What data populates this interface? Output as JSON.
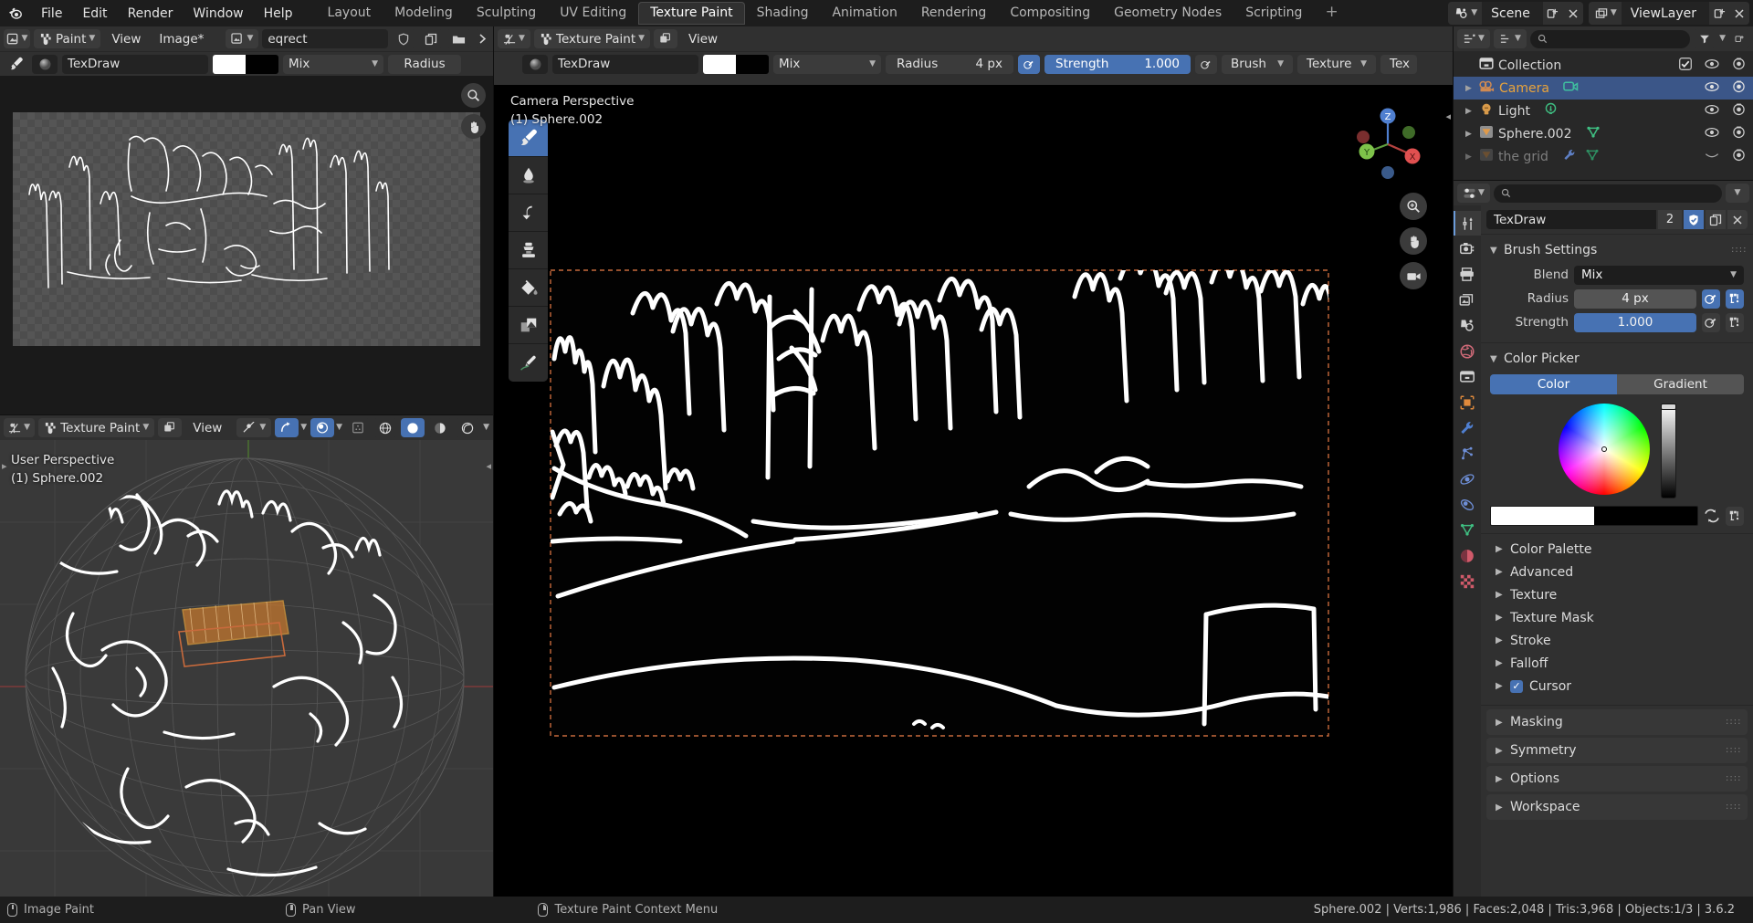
{
  "app": {
    "title": "Blender",
    "version": "3.6.2"
  },
  "topbar": {
    "logo_icon": "blender-logo-icon",
    "menus": [
      "File",
      "Edit",
      "Render",
      "Window",
      "Help"
    ],
    "workspace_tabs": [
      {
        "label": "Layout",
        "active": false
      },
      {
        "label": "Modeling",
        "active": false
      },
      {
        "label": "Sculpting",
        "active": false
      },
      {
        "label": "UV Editing",
        "active": false
      },
      {
        "label": "Texture Paint",
        "active": true
      },
      {
        "label": "Shading",
        "active": false
      },
      {
        "label": "Animation",
        "active": false
      },
      {
        "label": "Rendering",
        "active": false
      },
      {
        "label": "Compositing",
        "active": false
      },
      {
        "label": "Geometry Nodes",
        "active": false
      },
      {
        "label": "Scripting",
        "active": false
      }
    ],
    "add_workspace_label": "+",
    "scene": {
      "icon": "scene-icon",
      "name": "Scene",
      "new_icon": "new-scene-icon",
      "unlink_icon": "unlink-icon"
    },
    "viewlayer": {
      "icon": "view-layer-icon",
      "name": "ViewLayer"
    }
  },
  "image_editor": {
    "editor_type_icon": "image-editor-icon",
    "mode": "Paint",
    "menus": [
      "View",
      "Image*"
    ],
    "image_datablock": {
      "icon": "image-data-icon",
      "name": "eqrect",
      "fake_user_icon": "shield-icon",
      "copy_icon": "copy-icon",
      "open_icon": "folder-icon",
      "more_icon": "chevron-right-icon"
    },
    "tool_row": {
      "brush_icon": "brush-icon",
      "brush_preview_icon": "brush-preview-icon",
      "brush_name": "TexDraw",
      "color_primary": "#ffffff",
      "color_secondary": "#010101",
      "blend": "Mix",
      "radius_label": "Radius"
    }
  },
  "viewport_left": {
    "editor_type_icon": "3d-viewport-icon",
    "mode": "Texture Paint",
    "overlay_icon": "mode-overlay-icon",
    "menus": [
      "View"
    ],
    "header_icons": [
      "visibility-icon",
      "snap-icon",
      "proportional-edit-icon",
      "show-gizmo-icon",
      "shading-wireframe-icon",
      "shading-solid-icon",
      "shading-material-icon",
      "shading-rendered-icon"
    ],
    "overlay_text_line1": "User Perspective",
    "overlay_text_line2": "(1) Sphere.002"
  },
  "viewport_main": {
    "editor_type_icon": "3d-viewport-icon",
    "mode": "Texture Paint",
    "overlay_icon": "mode-overlay-icon",
    "menus": [
      "View"
    ],
    "tool_row": {
      "brush_preview_icon": "brush-preview-icon",
      "brush_name": "TexDraw",
      "color_primary": "#ffffff",
      "color_secondary": "#010101",
      "blend": "Mix",
      "radius_label": "Radius",
      "radius_value": "4 px",
      "radius_pressure_icon": "pressure-icon",
      "strength_label": "Strength",
      "strength_value": "1.000",
      "strength_pressure_icon": "pressure-icon",
      "menus": [
        "Brush",
        "Texture",
        "Tex"
      ]
    },
    "overlay_text_line1": "Camera Perspective",
    "overlay_text_line2": "(1) Sphere.002",
    "toolbar": [
      {
        "name": "draw-tool",
        "icon": "brush-icon",
        "active": true
      },
      {
        "name": "soften-tool",
        "icon": "soften-drop-icon",
        "active": false
      },
      {
        "name": "smear-tool",
        "icon": "smear-icon",
        "active": false
      },
      {
        "name": "clone-tool",
        "icon": "clone-stamp-icon",
        "active": false
      },
      {
        "name": "fill-tool",
        "icon": "fill-bucket-icon",
        "active": false
      },
      {
        "name": "mask-tool",
        "icon": "mask-icon",
        "active": false
      },
      {
        "name": "annotate-tool",
        "icon": "annotate-pencil-icon",
        "active": false
      }
    ],
    "gizmo_axes": [
      "Z",
      "X",
      "Y"
    ],
    "nav_buttons": [
      "zoom-icon",
      "hand-pan-icon",
      "camera-view-icon"
    ]
  },
  "outliner": {
    "display_mode_icon": "outliner-icon",
    "filter_icon": "filter-icon",
    "search_placeholder": "",
    "search_icon": "search-icon",
    "new_collection_icon": "new-collection-icon",
    "rows": [
      {
        "label": "Collection",
        "icon": "collection-icon",
        "indent": 0,
        "expand": "",
        "selected": false,
        "dim": false,
        "checkbox": true,
        "hide": "eye-icon",
        "render": "camera-render-icon",
        "datatype": ""
      },
      {
        "label": "Camera",
        "icon": "camera-object-icon",
        "indent": 1,
        "expand": "▶",
        "selected": true,
        "dim": false,
        "checkbox": false,
        "hide": "eye-icon",
        "render": "camera-render-icon",
        "datatype": "camera-data-icon"
      },
      {
        "label": "Light",
        "icon": "light-object-icon",
        "indent": 1,
        "expand": "▶",
        "selected": false,
        "dim": false,
        "checkbox": false,
        "hide": "eye-icon",
        "render": "camera-render-icon",
        "datatype": "light-data-icon"
      },
      {
        "label": "Sphere.002",
        "icon": "mesh-object-icon",
        "indent": 1,
        "expand": "▶",
        "selected": false,
        "dim": false,
        "checkbox": false,
        "hide": "eye-icon",
        "render": "camera-render-icon",
        "datatype": "mesh-data-icon"
      },
      {
        "label": "the grid",
        "icon": "mesh-object-icon",
        "indent": 1,
        "expand": "▶",
        "selected": false,
        "dim": true,
        "checkbox": false,
        "hide": "eye-closed-icon",
        "render": "camera-render-icon",
        "datatype": "modifier-wrench-icon"
      }
    ]
  },
  "properties": {
    "editor_type_icon": "properties-icon",
    "pin_icon": "pin-icon",
    "search_placeholder": "",
    "search_icon": "search-icon",
    "options_icon": "chevron-down-icon",
    "tabs": [
      {
        "name": "tool-tab",
        "icon": "tool-wrench-screwdriver-icon",
        "active": true,
        "color": "#d0d0d0"
      },
      {
        "name": "render-tab",
        "icon": "render-camera-icon",
        "active": false,
        "color": "#d0d0d0"
      },
      {
        "name": "output-tab",
        "icon": "output-printer-icon",
        "active": false,
        "color": "#d0d0d0"
      },
      {
        "name": "view-layer-tab",
        "icon": "view-layer-images-icon",
        "active": false,
        "color": "#d0d0d0"
      },
      {
        "name": "scene-tab",
        "icon": "scene-cone-icon",
        "active": false,
        "color": "#d0d0d0"
      },
      {
        "name": "world-tab",
        "icon": "world-globe-icon",
        "active": false,
        "color": "#d06a78"
      },
      {
        "name": "collection-tab",
        "icon": "collection-box-icon",
        "active": false,
        "color": "#d0d0d0"
      },
      {
        "name": "object-tab",
        "icon": "object-square-icon",
        "active": false,
        "color": "#e08a3c"
      },
      {
        "name": "modifier-tab",
        "icon": "modifier-wrench-icon",
        "active": false,
        "color": "#4f7fd0"
      },
      {
        "name": "particles-tab",
        "icon": "particles-icon",
        "active": false,
        "color": "#6e8fd8"
      },
      {
        "name": "physics-tab",
        "icon": "physics-orbit-icon",
        "active": false,
        "color": "#6e8fd8"
      },
      {
        "name": "constraints-tab",
        "icon": "constraints-icon",
        "active": false,
        "color": "#6e8fd8"
      },
      {
        "name": "data-tab",
        "icon": "mesh-data-triangle-icon",
        "active": false,
        "color": "#3fbf82"
      },
      {
        "name": "material-tab",
        "icon": "material-sphere-icon",
        "active": false,
        "color": "#d05a6a"
      },
      {
        "name": "texture-tab",
        "icon": "texture-checker-icon",
        "active": false,
        "color": "#d05a6a"
      }
    ],
    "brush_id": {
      "name": "TexDraw",
      "users_count": "2",
      "fake_user_icon": "shield-icon",
      "copy_icon": "copy-icon",
      "unlink_icon": "x-icon"
    },
    "brush_settings": {
      "title": "Brush Settings",
      "grip_icon": "drag-grip-icon",
      "fields": [
        {
          "label": "Blend",
          "value": "Mix",
          "type": "dropdown",
          "name": "blend-dropdown"
        },
        {
          "label": "Radius",
          "value": "4 px",
          "type": "slider",
          "filled": false,
          "name": "radius-slider",
          "btn1": "pressure-icon",
          "btn1_on": true,
          "btn2": "unified-icon",
          "btn2_on": true
        },
        {
          "label": "Strength",
          "value": "1.000",
          "type": "slider",
          "filled": true,
          "name": "strength-slider",
          "btn1": "pressure-icon",
          "btn1_on": false,
          "btn2": "unified-icon",
          "btn2_on": false
        }
      ]
    },
    "color_picker": {
      "title": "Color Picker",
      "tabs": [
        {
          "label": "Color",
          "active": true
        },
        {
          "label": "Gradient",
          "active": false
        }
      ],
      "wheel_icon": "color-wheel-icon",
      "value_slider_icon": "value-slider-icon",
      "primary_color": "#ffffff",
      "secondary_color": "#000000",
      "swap_icon": "swap-colors-icon",
      "unified_icon": "unified-color-icon"
    },
    "sub_sections": [
      {
        "label": "Color Palette",
        "expanded": false,
        "checkbox": null,
        "name": "color-palette-section"
      },
      {
        "label": "Advanced",
        "expanded": false,
        "checkbox": null,
        "name": "advanced-section"
      },
      {
        "label": "Texture",
        "expanded": false,
        "checkbox": null,
        "name": "texture-section"
      },
      {
        "label": "Texture Mask",
        "expanded": false,
        "checkbox": null,
        "name": "texture-mask-section"
      },
      {
        "label": "Stroke",
        "expanded": false,
        "checkbox": null,
        "name": "stroke-section"
      },
      {
        "label": "Falloff",
        "expanded": false,
        "checkbox": null,
        "name": "falloff-section"
      },
      {
        "label": "Cursor",
        "expanded": false,
        "checkbox": true,
        "name": "cursor-section"
      }
    ],
    "main_sections": [
      {
        "label": "Masking",
        "expanded": false,
        "name": "masking-section"
      },
      {
        "label": "Symmetry",
        "expanded": false,
        "name": "symmetry-section"
      },
      {
        "label": "Options",
        "expanded": false,
        "name": "options-section"
      },
      {
        "label": "Workspace",
        "expanded": false,
        "name": "workspace-section"
      }
    ]
  },
  "statusbar": {
    "keymap": [
      {
        "icon": "mouse-left-icon",
        "label": "Image Paint"
      },
      {
        "icon": "mouse-middle-icon",
        "label": "Pan View"
      },
      {
        "icon": "mouse-right-icon",
        "label": "Texture Paint Context Menu"
      }
    ],
    "scene_stats": "Sphere.002 | Verts:1,986 | Faces:2,048 | Tris:3,968 | Objects:1/3 | 3.6.2"
  },
  "colors": {
    "accent_blue": "#4772b3",
    "select_orange": "#e8a33c",
    "camera_frame": "#c86a3c",
    "panel_bg": "#303030",
    "editor_bg": "#282828",
    "topbar_bg": "#1d1d1d"
  }
}
